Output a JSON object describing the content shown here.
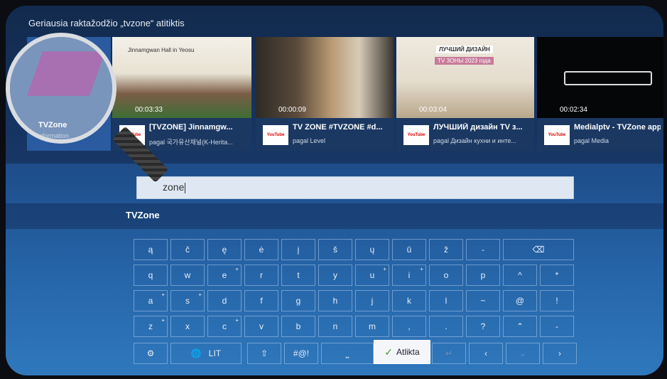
{
  "results": {
    "heading": "Geriausia raktažodžio „tvzone“ atitiktis",
    "app_tile": {
      "name": "TVZone",
      "info": "Information"
    },
    "videos": [
      {
        "title": "[TVZONE] Jinnamgw...",
        "channel": "pagal 국가유산채널(K-Herita...",
        "duration": "00:03:33",
        "source": "YouTube",
        "thumb_caption": "Jinnamgwan Hall in Yeosu"
      },
      {
        "title": "TV ZONE #TVZONE #d...",
        "channel": "pagal Level",
        "duration": "00:00:09",
        "source": "YouTube"
      },
      {
        "title": "ЛУЧШИЙ дизайн TV з...",
        "channel": "pagal Дизайн кухни и инте...",
        "duration": "00:03:04",
        "source": "YouTube",
        "thumb_caption": "ЛУЧШИЙ ДИЗАЙН",
        "thumb_caption2": "TV ЗОНЫ 2023 года"
      },
      {
        "title": "Medialptv - TVZone apps",
        "channel": "pagal Media",
        "duration": "00:02:34",
        "source": "YouTube"
      }
    ]
  },
  "search": {
    "value": "tvzone",
    "visible_value": "zone"
  },
  "suggestion": {
    "text": "TVZone"
  },
  "keyboard": {
    "rows": [
      [
        {
          "k": "ą"
        },
        {
          "k": "č"
        },
        {
          "k": "ę"
        },
        {
          "k": "ė"
        },
        {
          "k": "į"
        },
        {
          "k": "š"
        },
        {
          "k": "ų"
        },
        {
          "k": "ū"
        },
        {
          "k": "ž"
        },
        {
          "k": "-"
        }
      ],
      [
        {
          "k": "q"
        },
        {
          "k": "w"
        },
        {
          "k": "e",
          "plus": true
        },
        {
          "k": "r"
        },
        {
          "k": "t"
        },
        {
          "k": "y"
        },
        {
          "k": "u",
          "plus": true
        },
        {
          "k": "i",
          "plus": true
        },
        {
          "k": "o"
        },
        {
          "k": "p"
        },
        {
          "k": "^"
        },
        {
          "k": "*"
        }
      ],
      [
        {
          "k": "a",
          "plus": true
        },
        {
          "k": "s",
          "plus": true
        },
        {
          "k": "d"
        },
        {
          "k": "f"
        },
        {
          "k": "g"
        },
        {
          "k": "h"
        },
        {
          "k": "j"
        },
        {
          "k": "k"
        },
        {
          "k": "l"
        },
        {
          "k": "~"
        },
        {
          "k": "@"
        },
        {
          "k": "!"
        }
      ],
      [
        {
          "k": "z",
          "plus": true
        },
        {
          "k": "x"
        },
        {
          "k": "c",
          "plus": true
        },
        {
          "k": "v"
        },
        {
          "k": "b"
        },
        {
          "k": "n"
        },
        {
          "k": "m"
        },
        {
          "k": ","
        },
        {
          "k": "."
        },
        {
          "k": "?"
        },
        {
          "k": "⌃"
        },
        {
          "k": "-"
        }
      ]
    ],
    "lang_label": "LIT",
    "symbols_label": "#@!",
    "done_label": "Atlikta"
  },
  "colors": {
    "accent": "#2f78bd",
    "done_check": "#4a9a3e"
  }
}
